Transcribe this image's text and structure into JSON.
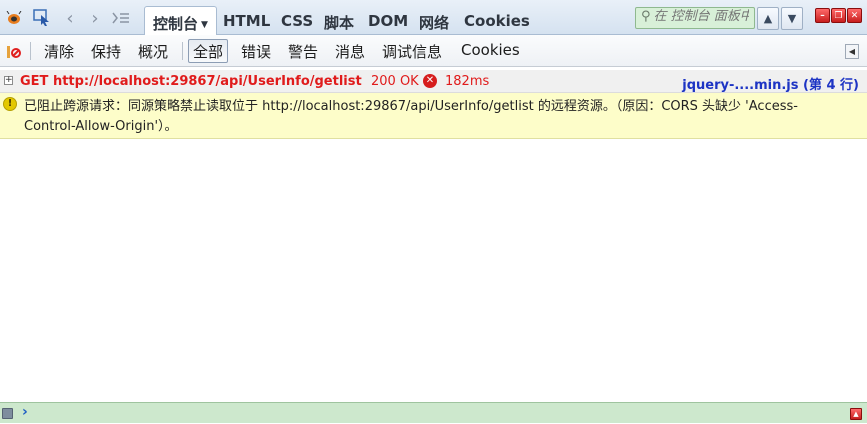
{
  "top_tabs": {
    "console": "控制台",
    "html": "HTML",
    "css": "CSS",
    "script": "脚本",
    "dom": "DOM",
    "net": "网络",
    "cookies": "Cookies"
  },
  "search": {
    "placeholder": "在 控制台 面板中搜索"
  },
  "toolbar": {
    "clear": "清除",
    "persist": "保持",
    "profile": "概况",
    "all": "全部",
    "errors": "错误",
    "warnings": "警告",
    "info": "消息",
    "debug": "调试信息",
    "cookies": "Cookies"
  },
  "log": {
    "request": {
      "method_url": "GET http://localhost:29867/api/UserInfo/getlist",
      "status": "200 OK",
      "time": "182ms",
      "source": "jquery-....min.js (第 4 行)"
    },
    "warning": {
      "text": "已阻止跨源请求：同源策略禁止读取位于 http://localhost:29867/api/UserInfo/getlist 的远程资源。（原因：CORS 头缺少 'Access-Control-Allow-Origin'）。"
    }
  },
  "command_line": {
    "prompt": "›",
    "value": ""
  },
  "colors": {
    "error_red": "#e01b1b",
    "link_blue": "#1d34c4",
    "warning_bg": "#fdfdc9",
    "cmdline_bg": "#cde8cd"
  },
  "icons": [
    "firebug-icon",
    "inspect-icon",
    "back-icon",
    "forward-icon",
    "menu-list-icon",
    "magnifier-icon",
    "arrow-up-icon",
    "arrow-down-icon",
    "minimize-icon",
    "restore-icon",
    "close-icon",
    "clear-console-icon",
    "collapse-icon",
    "error-icon",
    "warning-icon"
  ]
}
